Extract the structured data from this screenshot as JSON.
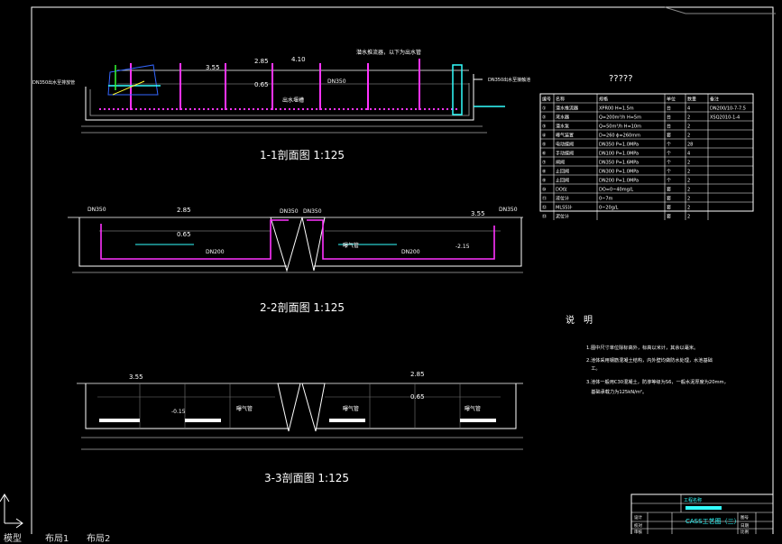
{
  "drawing": {
    "section1": {
      "title": "1-1剖面图 1:125",
      "label_left": "DN350出水至排放管",
      "label_right": "DN350出水至接触池",
      "top_note": "潜水推流器，以下为出水管",
      "dims": {
        "a": "3.55",
        "b": "2.85",
        "c": "4.10",
        "d": "0.65",
        "e": "DN350",
        "f": "出水堰槽"
      }
    },
    "section2": {
      "title": "2-2剖面图 1:125",
      "dims": {
        "a": "DN350",
        "b": "2.85",
        "c": "0.65",
        "d": "DN350",
        "e": "DN350",
        "f": "3.55",
        "g": "DN200",
        "h": "DN200",
        "i": "-2.15",
        "j": "曝气管",
        "k": "DN350"
      }
    },
    "section3": {
      "title": "3-3剖面图 1:125",
      "dims": {
        "a": "3.55",
        "b": "2.85",
        "c": "0.65",
        "d": "-0.15",
        "e": "曝气管",
        "f": "曝气管",
        "g": "曝气管"
      }
    },
    "table_title": "?????",
    "table": {
      "headers": [
        "编号",
        "名称",
        "规格",
        "单位",
        "数量",
        "备注"
      ],
      "rows": [
        [
          "①",
          "潜水推流器",
          "XPR00 H=1.5m",
          "台",
          "4",
          "DN200/10-7-7.5"
        ],
        [
          "②",
          "滗水器",
          "Q=200m³/h H=5m",
          "台",
          "2",
          "XSQ2010-1-4"
        ],
        [
          "③",
          "潜水泵",
          "Q=50m³/h H=10m",
          "台",
          "2",
          ""
        ],
        [
          "④",
          "曝气装置",
          "D=260 ϕ=260mm",
          "套",
          "2",
          ""
        ],
        [
          "⑤",
          "电动蝶阀",
          "DN350 P=1.0MPa",
          "个",
          "28",
          ""
        ],
        [
          "⑥",
          "手动蝶阀",
          "DN100 P=1.0MPa",
          "个",
          "4",
          ""
        ],
        [
          "⑦",
          "闸阀",
          "DN350 P=1.6MPa",
          "个",
          "2",
          ""
        ],
        [
          "⑧",
          "止回阀",
          "DN300 P=1.0MPa",
          "个",
          "2",
          ""
        ],
        [
          "⑨",
          "止回阀",
          "DN200 P=1.0MPa",
          "个",
          "2",
          ""
        ],
        [
          "⑩",
          "DO仪",
          "DO=0~40mg/L",
          "套",
          "2",
          ""
        ],
        [
          "⑪",
          "液位计",
          "0~7m",
          "套",
          "2",
          ""
        ],
        [
          "⑫",
          "MLSS计",
          "0~20g/L",
          "套",
          "2",
          ""
        ],
        [
          "⑬",
          "泥位计",
          "",
          "套",
          "2",
          ""
        ]
      ]
    },
    "notes": {
      "title": "说　明",
      "lines": [
        "1.图中尺寸单位除标高外，标高以米计，其余以毫米。",
        "2.池体采用钢筋混凝土结构，内外壁均做防水处理，水池基础",
        "　工。",
        "3.池体一般用C30混凝土，防渗等级为S6，一般水泥厚度为20mm，",
        "　基础承载力为125kN/m²。"
      ]
    },
    "title_block": {
      "project": "工程名称",
      "drawing_name": "CASS工艺图（三）",
      "r1": "设计",
      "r2": "校对",
      "r3": "审核",
      "s1": "图号",
      "s2": "日期",
      "s3": "比例"
    }
  },
  "tabs": {
    "model": "模型",
    "layout1": "布局1",
    "layout2": "布局2"
  },
  "colors": {
    "bg": "#000000",
    "line": "#ffffff",
    "magenta": "#ff33ff",
    "cyan": "#33ffff",
    "blue": "#3366ff",
    "yellow": "#ffff33",
    "green": "#33ff33"
  }
}
